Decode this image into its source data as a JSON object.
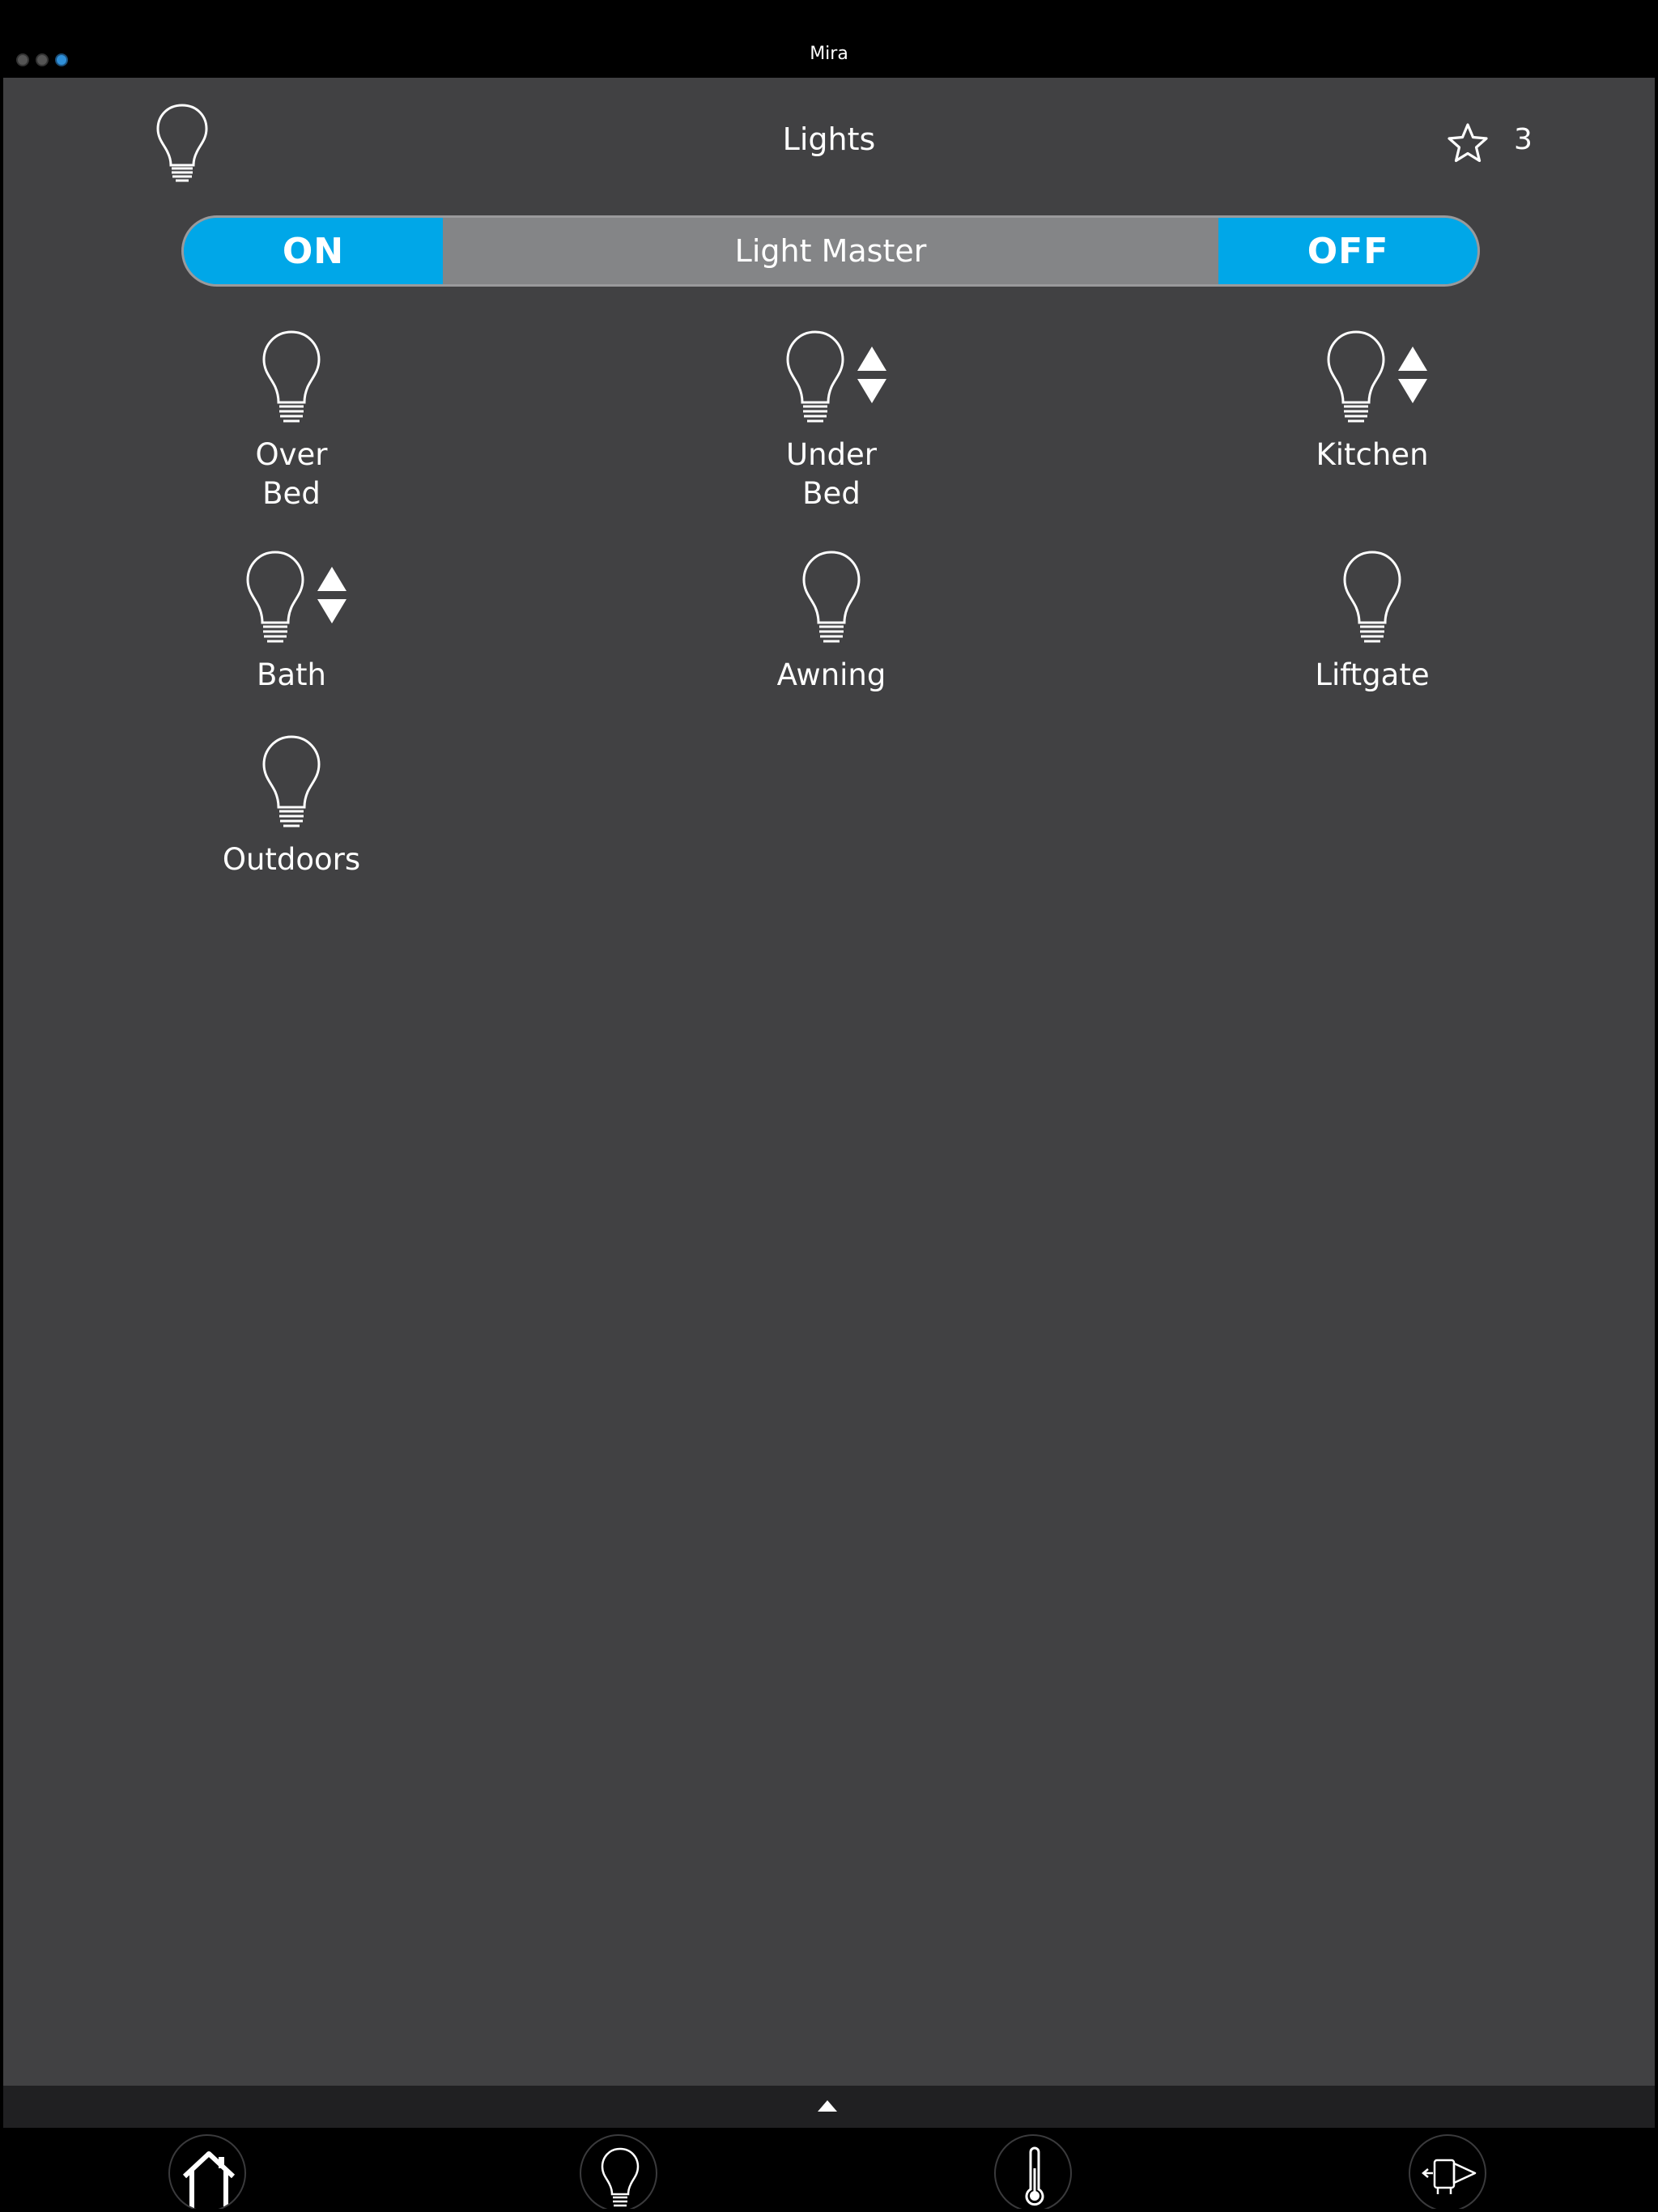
{
  "app": {
    "title": "Mira"
  },
  "header": {
    "title": "Lights",
    "favorite_count": "3",
    "icon": "lightbulb-icon",
    "favorite_icon": "star-icon"
  },
  "master": {
    "on_label": "ON",
    "label": "Light Master",
    "off_label": "OFF"
  },
  "lights": [
    {
      "label": "Over\nBed",
      "dimmable": false
    },
    {
      "label": "Under\nBed",
      "dimmable": true
    },
    {
      "label": "Kitchen",
      "dimmable": true
    },
    {
      "label": "Bath",
      "dimmable": true
    },
    {
      "label": "Awning",
      "dimmable": false
    },
    {
      "label": "Liftgate",
      "dimmable": false
    },
    {
      "label": "Outdoors",
      "dimmable": false
    }
  ],
  "tabs": [
    {
      "icon": "home-icon"
    },
    {
      "icon": "lightbulb-icon"
    },
    {
      "icon": "thermometer-icon"
    },
    {
      "icon": "slide-out-icon"
    }
  ],
  "colors": {
    "accent": "#00a7e8",
    "background": "#414143",
    "master_bar": "#848587",
    "active_dot": "#2f8fd8"
  }
}
